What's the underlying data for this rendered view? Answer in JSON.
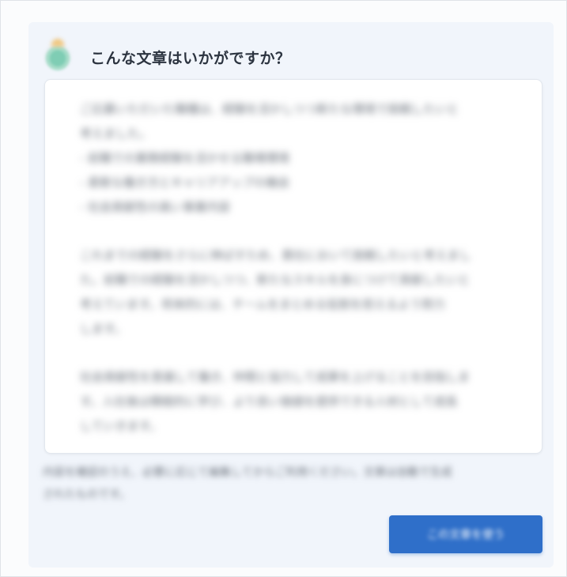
{
  "dialog": {
    "title": "こんな文章はいかがですか？",
    "suggestion": {
      "intro_lines": [
        "ご応募いただいた職種は、経験を活かしつつ新たな環境で挑戦したいと",
        "考えました。"
      ],
      "bullets": [
        "- 前職での業務経験を活かせる職場環境",
        "- 柔軟な働き方とキャリアアップの機会",
        "- 社会貢献性の高い事業内容"
      ],
      "para2_lines": [
        "これまでの経験をさらに伸ばすため、貴社において挑戦したいと考えまし",
        "た。前職での経験を活かしつつ、新たなスキルを身につけて貢献したいと",
        "考えています。将来的には、チームをまとめる役割を担えるよう努力",
        "します。"
      ],
      "para3_lines": [
        "社会貢献性を意識して働き、仲間と協力して成果を上げることを目指しま",
        "す。入社後は積極的に学び、より良い価値を提供できる人材として成長",
        "していきます。"
      ]
    },
    "note_lines": [
      "内容を確認のうえ、必要に応じて編集してからご利用ください。文章は自動で生成",
      "されたものです。"
    ],
    "use_button_label": "この文章を使う"
  }
}
